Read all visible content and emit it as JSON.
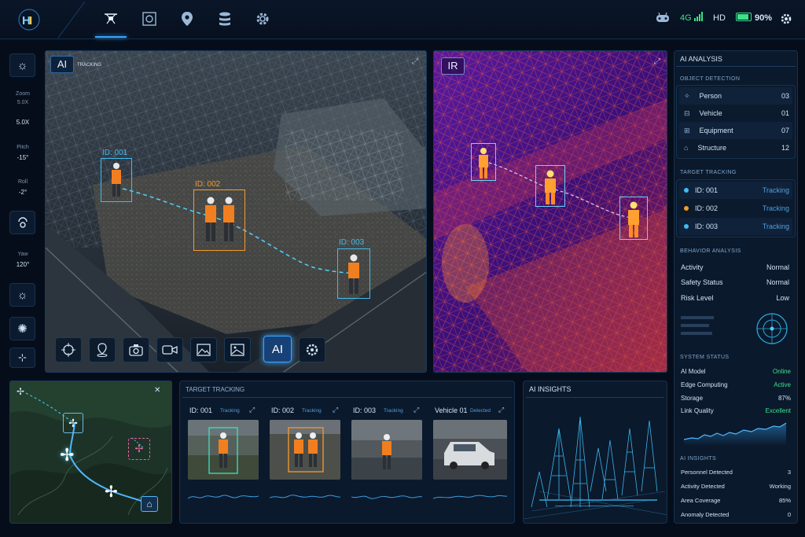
{
  "colors": {
    "accent": "#3aa6ff",
    "orange": "#f59a2b",
    "green": "#3ee08a",
    "cyan": "#4fd2ff"
  },
  "topbar": {
    "nav_icons": [
      "drone-icon",
      "target-camera-icon",
      "location-pin-icon",
      "database-icon",
      "gear-icon"
    ],
    "signal": "4G",
    "quality": "HD",
    "battery": "90%",
    "battery_level": 0.9
  },
  "left_toolbar": {
    "zoom_label": "Zoom",
    "zoom_sub": "5.0X",
    "zoom_value": "5.0X",
    "pitch_label": "Pitch",
    "pitch_value": "-15°",
    "roll_label": "Roll",
    "roll_value": "-2°",
    "yaw_label": "Yaw",
    "yaw_value": "120°"
  },
  "ai_view": {
    "badge": "AI",
    "status": "TRACKING",
    "targets": [
      {
        "label": "ID: 001",
        "color": "#3fbdf0"
      },
      {
        "label": "ID: 002",
        "color": "#f59a2b"
      },
      {
        "label": "ID: 003",
        "color": "#3fbdf0"
      }
    ],
    "toolbar_active": "AI"
  },
  "ir_view": {
    "badge": "IR"
  },
  "right_panel": {
    "title": "AI ANALYSIS",
    "object_detection": {
      "title": "OBJECT DETECTION",
      "items": [
        {
          "label": "Person",
          "value": "03"
        },
        {
          "label": "Vehicle",
          "value": "01"
        },
        {
          "label": "Equipment",
          "value": "07"
        },
        {
          "label": "Structure",
          "value": "12"
        }
      ]
    },
    "target_tracking": {
      "title": "TARGET TRACKING",
      "items": [
        {
          "label": "ID: 001",
          "status": "Tracking",
          "dot": "#3fbdf0"
        },
        {
          "label": "ID: 002",
          "status": "Tracking",
          "dot": "#f59a2b"
        },
        {
          "label": "ID: 003",
          "status": "Tracking",
          "dot": "#3fbdf0"
        }
      ]
    },
    "behavior": {
      "title": "BEHAVIOR ANALYSIS",
      "items": [
        {
          "label": "Activity",
          "value": "Normal"
        },
        {
          "label": "Safety Status",
          "value": "Normal"
        },
        {
          "label": "Risk Level",
          "value": "Low"
        }
      ]
    },
    "system": {
      "title": "SYSTEM STATUS",
      "items": [
        {
          "label": "AI Model",
          "value": "Online"
        },
        {
          "label": "Edge Computing",
          "value": "Active"
        },
        {
          "label": "Storage",
          "value": "87%"
        },
        {
          "label": "Link Quality",
          "value": "Excellent"
        }
      ]
    },
    "insights": {
      "title": "AI INSIGHTS",
      "items": [
        {
          "label": "Personnel Detected",
          "value": "3"
        },
        {
          "label": "Activity Detected",
          "value": "Working"
        },
        {
          "label": "Area Coverage",
          "value": "85%"
        },
        {
          "label": "Anomaly Detected",
          "value": "0"
        }
      ]
    }
  },
  "tracking_panel": {
    "title": "TARGET TRACKING",
    "cards": [
      {
        "id": "ID: 001",
        "status": "Tracking"
      },
      {
        "id": "ID: 002",
        "status": "Tracking"
      },
      {
        "id": "ID: 003",
        "status": "Tracking"
      },
      {
        "id": "Vehicle 01",
        "status": "Detected"
      }
    ]
  },
  "insights_panel": {
    "title": "AI INSIGHTS"
  }
}
